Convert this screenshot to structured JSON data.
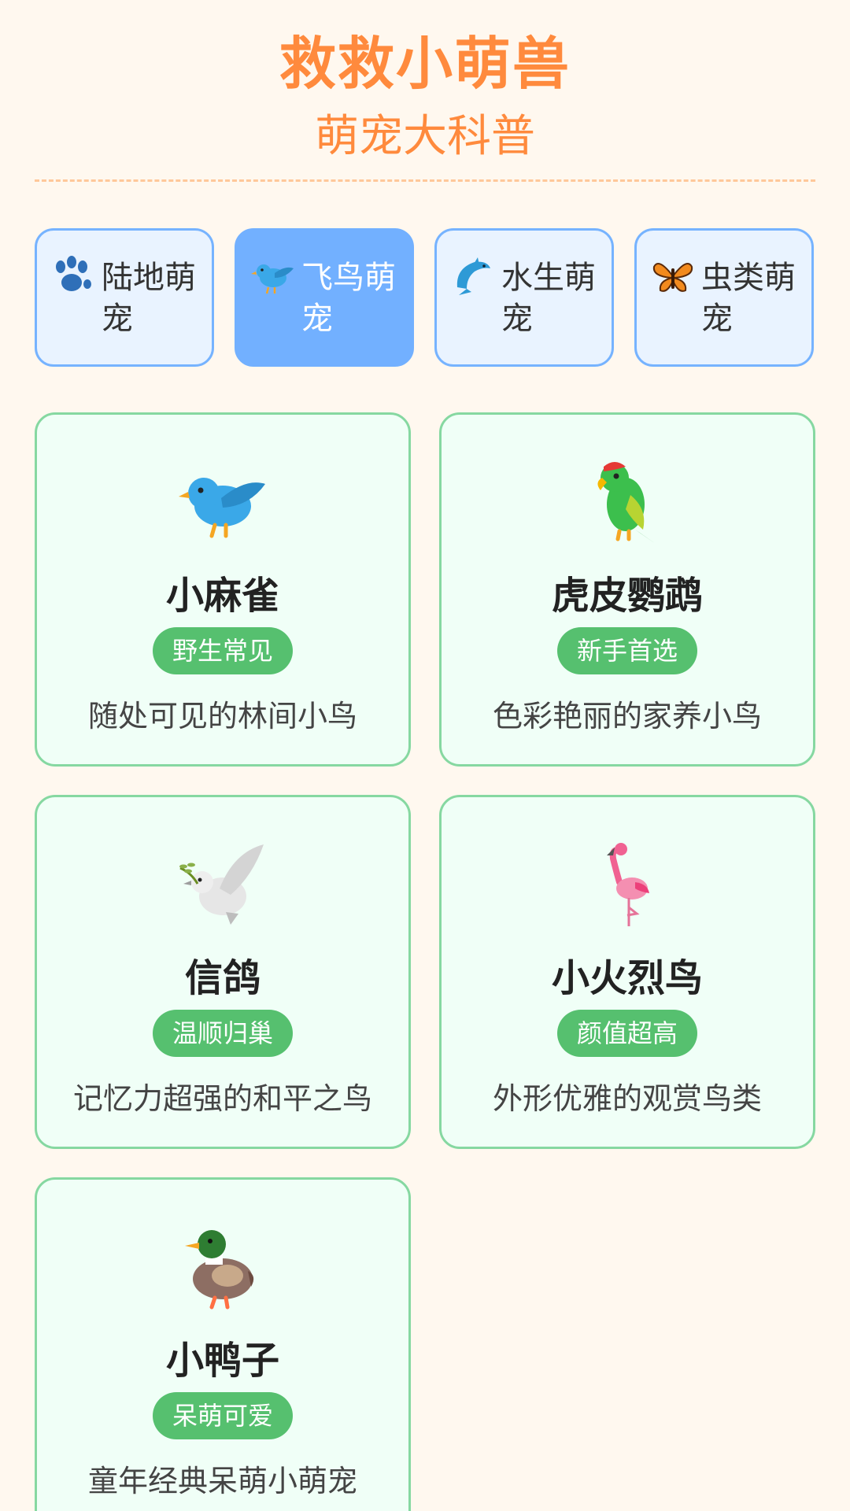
{
  "header": {
    "title": "救救小萌兽",
    "subtitle": "萌宠大科普"
  },
  "tabs": [
    {
      "label": "陆地萌宠",
      "icon": "paw-icon",
      "active": false
    },
    {
      "label": "飞鸟萌宠",
      "icon": "bird-icon",
      "active": true
    },
    {
      "label": "水生萌宠",
      "icon": "dolphin-icon",
      "active": false
    },
    {
      "label": "虫类萌宠",
      "icon": "butterfly-icon",
      "active": false
    }
  ],
  "cards": [
    {
      "name": "小麻雀",
      "tag": "野生常见",
      "desc": "随处可见的林间小鸟",
      "icon": "bluebird-icon"
    },
    {
      "name": "虎皮鹦鹉",
      "tag": "新手首选",
      "desc": "色彩艳丽的家养小鸟",
      "icon": "parrot-icon"
    },
    {
      "name": "信鸽",
      "tag": "温顺归巢",
      "desc": "记忆力超强的和平之鸟",
      "icon": "dove-icon"
    },
    {
      "name": "小火烈鸟",
      "tag": "颜值超高",
      "desc": "外形优雅的观赏鸟类",
      "icon": "flamingo-icon"
    },
    {
      "name": "小鸭子",
      "tag": "呆萌可爱",
      "desc": "童年经典呆萌小萌宠",
      "icon": "duck-icon"
    }
  ],
  "colors": {
    "accent": "#ff8a3d",
    "tab_active": "#72b0ff",
    "tab_border": "#76b3ff",
    "card_border": "#86d8a1",
    "tag_bg": "#56c06f",
    "background": "#fff8ef"
  }
}
